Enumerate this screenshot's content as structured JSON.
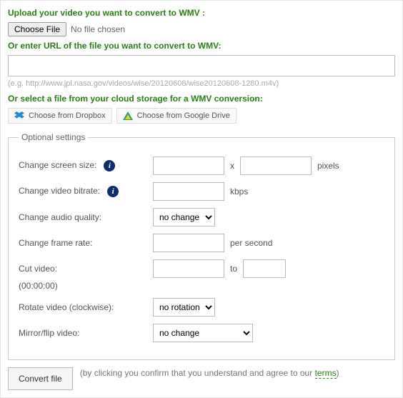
{
  "heading_upload": "Upload your video you want to convert to WMV :",
  "choose_file_label": "Choose File",
  "no_file_text": "No file chosen",
  "heading_url": "Or enter URL of the file you want to convert to WMV:",
  "url_value": "",
  "url_hint": "(e.g. http://www.jpl.nasa.gov/videos/wise/20120608/wise20120608-1280.m4v)",
  "heading_cloud": "Or select a file from your cloud storage for a WMV conversion:",
  "cloud": {
    "dropbox_label": "Choose from Dropbox",
    "gdrive_label": "Choose from Google Drive"
  },
  "fieldset_legend": "Optional settings",
  "rows": {
    "screen_size_label": "Change screen size:",
    "screen_x": "x",
    "screen_unit": "pixels",
    "bitrate_label": "Change video bitrate:",
    "bitrate_unit": "kbps",
    "audio_label": "Change audio quality:",
    "audio_selected": "no change",
    "framerate_label": "Change frame rate:",
    "framerate_unit": "per second",
    "cut_label": "Cut video:",
    "cut_to": "to",
    "cut_hint": "(00:00:00)",
    "rotate_label": "Rotate video (clockwise):",
    "rotate_selected": "no rotation",
    "mirror_label": "Mirror/flip video:",
    "mirror_selected": "no change"
  },
  "submit": {
    "button": "Convert file",
    "note_before": "(by clicking you confirm that you understand and agree to our ",
    "terms": "terms",
    "note_after": ")"
  }
}
